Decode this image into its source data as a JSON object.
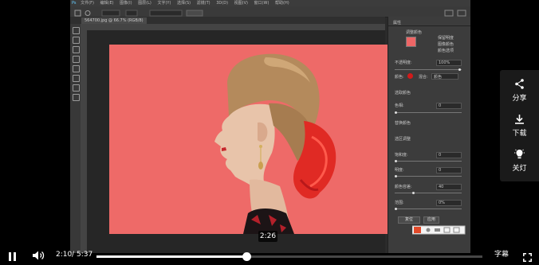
{
  "video": {
    "ps": {
      "menu": [
        "文件(F)",
        "编辑(E)",
        "图像(I)",
        "图层(L)",
        "文字(Y)",
        "选择(S)",
        "滤镜(T)",
        "3D(D)",
        "视图(V)",
        "窗口(W)",
        "帮助(H)"
      ],
      "tab_label": "564700.jpg @ 66.7% (RGB/8)",
      "panel": {
        "title": "属性",
        "radio1": "调整颜色",
        "opt1": "保留明度",
        "opt2": "图像颜色",
        "opt3": "颜色选项",
        "opacity_label": "不透明度:",
        "opacity_value": "100%",
        "color_label": "颜色:",
        "blend_label": "混合:",
        "blend_value": "颜色",
        "section1": "选取颜色",
        "hue_label": "色相:",
        "hue_value": "0",
        "section2": "替换颜色",
        "section3": "选区调整",
        "sat_label": "饱和度:",
        "sat_value": "0",
        "light_label": "明度:",
        "light_value": "0",
        "fuzz_label": "颜色容差:",
        "fuzz_value": "40",
        "range_label": "范围:",
        "range_value": "0%",
        "btn_reset": "复位",
        "btn_apply": "应用"
      }
    },
    "accent": "#ee6a68"
  },
  "tooltip": {
    "time": "2:26"
  },
  "player": {
    "current_time": "2:10",
    "separator": "/",
    "total_time": "5:37",
    "progress": 0.388,
    "subtitle_label": "字幕"
  },
  "side": {
    "share_label": "分享",
    "download_label": "下载",
    "lights_label": "关灯"
  }
}
